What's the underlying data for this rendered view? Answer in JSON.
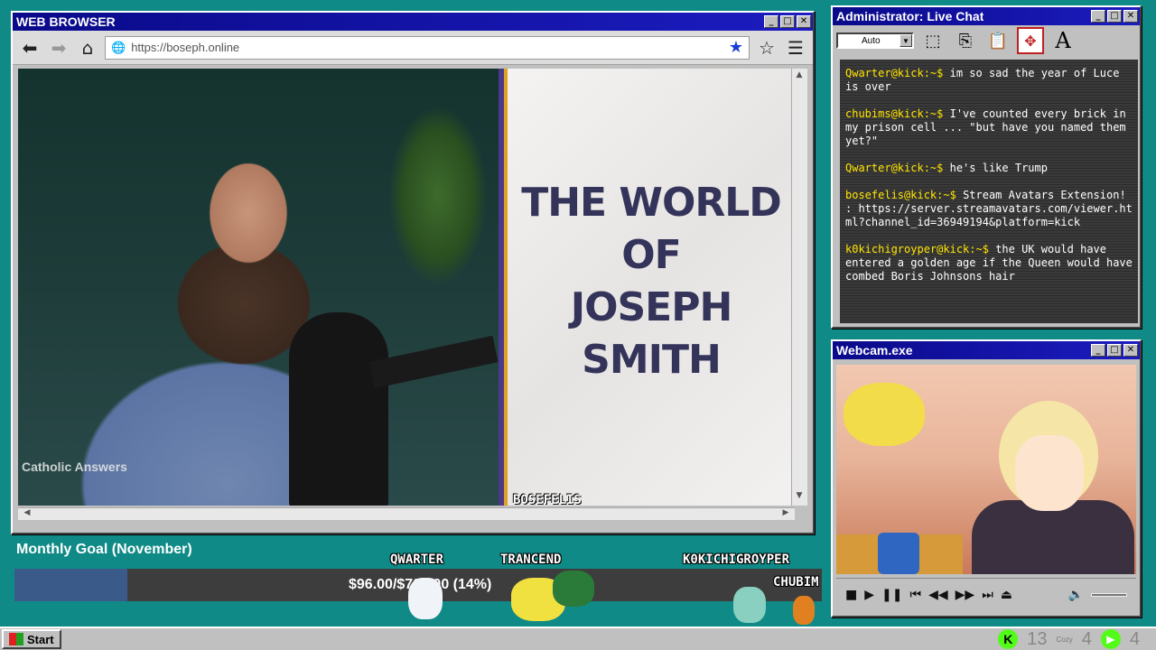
{
  "browser": {
    "title": "WEB BROWSER",
    "url": "https://boseph.online",
    "video": {
      "watermark": "Catholic Answers",
      "title_lines": [
        "THE WORLD",
        "OF",
        "JOSEPH SMITH"
      ],
      "overlay_name": "BOSEFELIS"
    }
  },
  "chat": {
    "title": "Administrator: Live Chat",
    "size_select": "Auto",
    "font_tool": "A",
    "messages": [
      {
        "user": "Qwarter@kick:~$",
        "text": "im so sad the year of Luce is over"
      },
      {
        "user": "chubims@kick:~$",
        "text": "I've counted every brick in my prison cell ... \"but have you named them yet?\""
      },
      {
        "user": "Qwarter@kick:~$",
        "text": "he's like Trump"
      },
      {
        "user": "bosefelis@kick:~$",
        "text": "Stream Avatars Extension! : https://server.streamavatars.com/viewer.html?channel_id=36949194&platform=kick"
      },
      {
        "user": "k0kichigroyper@kick:~$",
        "text": "the UK would have entered a golden age if the Queen would have combed Boris Johnsons hair"
      }
    ]
  },
  "webcam": {
    "title": "Webcam.exe"
  },
  "goal": {
    "title": "Monthly Goal (November)",
    "text": "$96.00/$700.00 (14%)",
    "percent": 14
  },
  "avatars": [
    "QWARTER",
    "TRANCEND",
    "K0KICHIGROYPER",
    "CHUBIM"
  ],
  "taskbar": {
    "start_label": "Start",
    "kick_letter": "K",
    "count1": "13",
    "cozy_label": "Cozy",
    "count2": "4",
    "count3": "4"
  }
}
